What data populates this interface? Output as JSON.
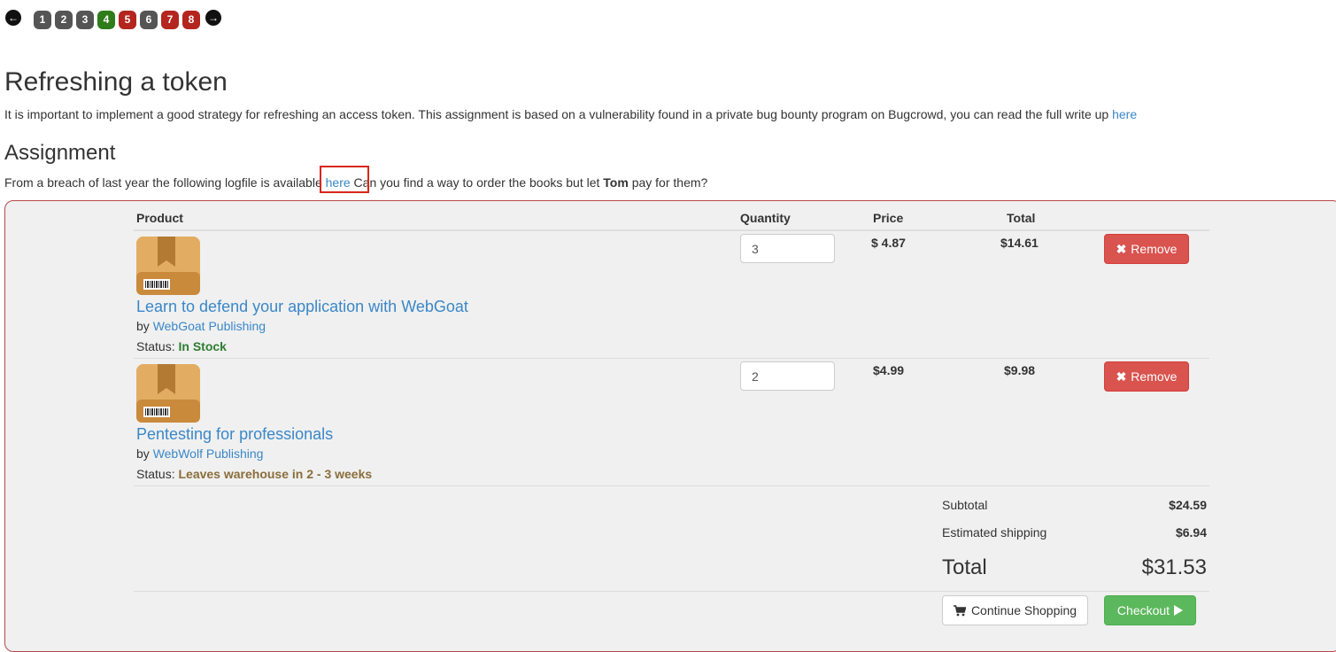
{
  "pager": {
    "prev_icon": "arrow-left-circle",
    "next_icon": "arrow-right-circle",
    "pages": [
      {
        "label": "1",
        "color": "#555555"
      },
      {
        "label": "2",
        "color": "#555555"
      },
      {
        "label": "3",
        "color": "#555555"
      },
      {
        "label": "4",
        "color": "#2e7d1a"
      },
      {
        "label": "5",
        "color": "#b3251e"
      },
      {
        "label": "6",
        "color": "#555555"
      },
      {
        "label": "7",
        "color": "#b3251e"
      },
      {
        "label": "8",
        "color": "#b3251e"
      }
    ]
  },
  "lesson": {
    "title": "Refreshing a token",
    "intro_text": "It is important to implement a good strategy for refreshing an access token. This assignment is based on a vulnerability found in a private bug bounty program on Bugcrowd, you can read the full write up ",
    "intro_link": "here",
    "assignment_heading": "Assignment",
    "assignment_text_before": "From a breach of last year the following logfile is available ",
    "assignment_link": "here",
    "assignment_text_mid": " Can you find a way to order the books but let ",
    "assignment_name": "Tom",
    "assignment_text_after": " pay for them?"
  },
  "cart": {
    "headers": {
      "product": "Product",
      "quantity": "Quantity",
      "price": "Price",
      "total": "Total"
    },
    "items": [
      {
        "title": "Learn to defend your application with WebGoat",
        "by": "by",
        "publisher": "WebGoat Publishing",
        "status_label": "Status:",
        "status": "In Stock",
        "quantity": "3",
        "price": "$ 4.87",
        "total": "$14.61",
        "remove_label": "Remove"
      },
      {
        "title": "Pentesting for professionals",
        "by": "by",
        "publisher": "WebWolf Publishing",
        "status_label": "Status:",
        "status": "Leaves warehouse in 2 - 3 weeks",
        "quantity": "2",
        "price": "$4.99",
        "total": "$9.98",
        "remove_label": "Remove"
      }
    ],
    "summary": {
      "subtotal_label": "Subtotal",
      "subtotal": "$24.59",
      "shipping_label": "Estimated shipping",
      "shipping": "$6.94",
      "total_label": "Total",
      "total": "$31.53"
    },
    "continue_label": "Continue Shopping",
    "checkout_label": "Checkout"
  }
}
